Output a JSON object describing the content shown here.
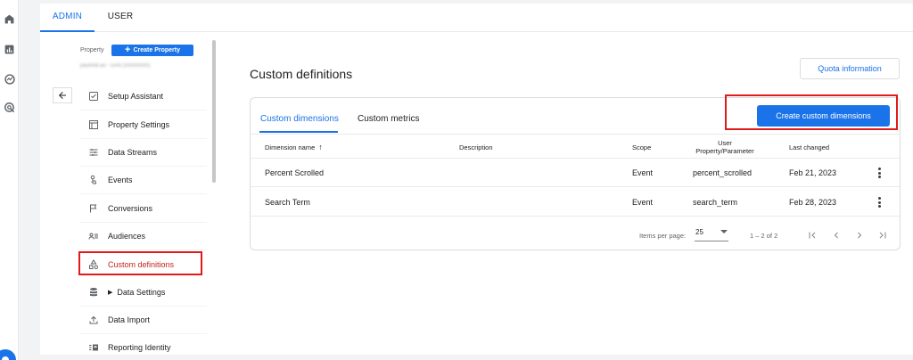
{
  "tabs": {
    "admin": "ADMIN",
    "user": "USER"
  },
  "rail": {
    "icons": [
      "home-icon",
      "bar-chart-icon",
      "explore-icon",
      "advertising-icon",
      "settings-icon"
    ]
  },
  "property": {
    "label": "Property",
    "create_button": "Create Property",
    "account_text": "paulmill.au - GA4 (00000000)"
  },
  "nav": {
    "items": [
      {
        "label": "Setup Assistant",
        "icon": "checkbox-icon"
      },
      {
        "label": "Property Settings",
        "icon": "property-settings-icon"
      },
      {
        "label": "Data Streams",
        "icon": "data-streams-icon"
      },
      {
        "label": "Events",
        "icon": "touch-icon"
      },
      {
        "label": "Conversions",
        "icon": "flag-icon"
      },
      {
        "label": "Audiences",
        "icon": "audiences-icon"
      },
      {
        "label": "Custom definitions",
        "icon": "shapes-icon"
      },
      {
        "label": "Data Settings",
        "icon": "database-icon"
      },
      {
        "label": "Data Import",
        "icon": "upload-icon"
      },
      {
        "label": "Reporting Identity",
        "icon": "reporting-identity-icon"
      }
    ]
  },
  "main": {
    "title": "Custom definitions",
    "quota_button": "Quota information",
    "create_button": "Create custom dimensions",
    "tabs": {
      "dimensions": "Custom dimensions",
      "metrics": "Custom metrics"
    }
  },
  "table": {
    "headers": {
      "name": "Dimension name",
      "description": "Description",
      "scope": "Scope",
      "param_line1": "User",
      "param_line2": "Property/Parameter",
      "changed": "Last changed"
    },
    "rows": [
      {
        "name": "Percent Scrolled",
        "description": "",
        "scope": "Event",
        "param": "percent_scrolled",
        "changed": "Feb 21, 2023"
      },
      {
        "name": "Search Term",
        "description": "",
        "scope": "Event",
        "param": "search_term",
        "changed": "Feb 28, 2023"
      }
    ]
  },
  "pager": {
    "items_per_page_label": "Items per page:",
    "items_per_page_value": "25",
    "range": "1 – 2 of 2"
  },
  "colors": {
    "accent": "#1a73e8",
    "highlight": "#e01a1a",
    "active_nav": "#c5221f"
  }
}
